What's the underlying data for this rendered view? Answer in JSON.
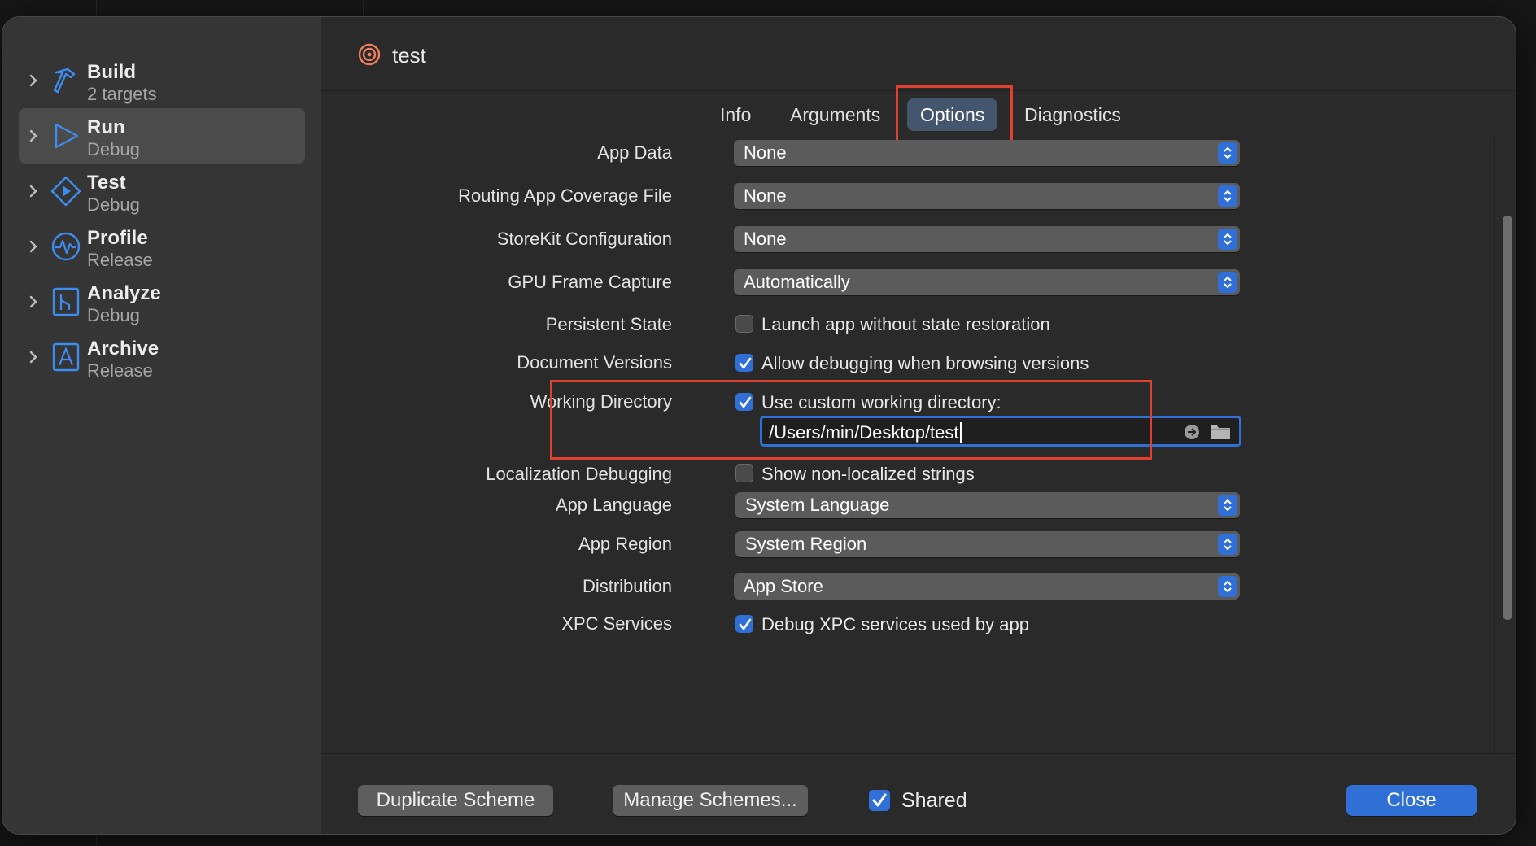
{
  "sidebar": {
    "items": [
      {
        "name": "Build",
        "sub": "2 targets",
        "icon": "hammer-icon"
      },
      {
        "name": "Run",
        "sub": "Debug",
        "icon": "play-icon"
      },
      {
        "name": "Test",
        "sub": "Debug",
        "icon": "test-diamond-icon"
      },
      {
        "name": "Profile",
        "sub": "Release",
        "icon": "waveform-icon"
      },
      {
        "name": "Analyze",
        "sub": "Debug",
        "icon": "analyze-icon"
      },
      {
        "name": "Archive",
        "sub": "Release",
        "icon": "archive-icon"
      }
    ],
    "selected": "Run"
  },
  "header": {
    "scheme_name": "test",
    "icon": "target-icon"
  },
  "tabs": [
    {
      "label": "Info"
    },
    {
      "label": "Arguments"
    },
    {
      "label": "Options",
      "active": true
    },
    {
      "label": "Diagnostics"
    }
  ],
  "options": {
    "app_data": {
      "label": "App Data",
      "value": "None"
    },
    "routing_coverage": {
      "label": "Routing App Coverage File",
      "value": "None"
    },
    "storekit": {
      "label": "StoreKit Configuration",
      "value": "None"
    },
    "gpu_capture": {
      "label": "GPU Frame Capture",
      "value": "Automatically"
    },
    "persistent_state": {
      "label": "Persistent State",
      "checkbox_label": "Launch app without state restoration",
      "checked": false
    },
    "document_versions": {
      "label": "Document Versions",
      "checkbox_label": "Allow debugging when browsing versions",
      "checked": true
    },
    "working_directory": {
      "label": "Working Directory",
      "checkbox_label": "Use custom working directory:",
      "checked": true,
      "path": "/Users/min/Desktop/test"
    },
    "localization_debugging": {
      "label": "Localization Debugging",
      "checkbox_label": "Show non-localized strings",
      "checked": false
    },
    "app_language": {
      "label": "App Language",
      "value": "System Language"
    },
    "app_region": {
      "label": "App Region",
      "value": "System Region"
    },
    "distribution": {
      "label": "Distribution",
      "value": "App Store"
    },
    "xpc_services": {
      "label": "XPC Services",
      "checkbox_label": "Debug XPC services used by app",
      "checked": true
    }
  },
  "footer": {
    "duplicate_label": "Duplicate Scheme",
    "manage_label": "Manage Schemes...",
    "shared_label": "Shared",
    "shared_checked": true,
    "close_label": "Close"
  },
  "colors": {
    "accent": "#2f6fd6",
    "highlight": "#e0412e",
    "sidebar_icon": "#3d8cf0"
  }
}
